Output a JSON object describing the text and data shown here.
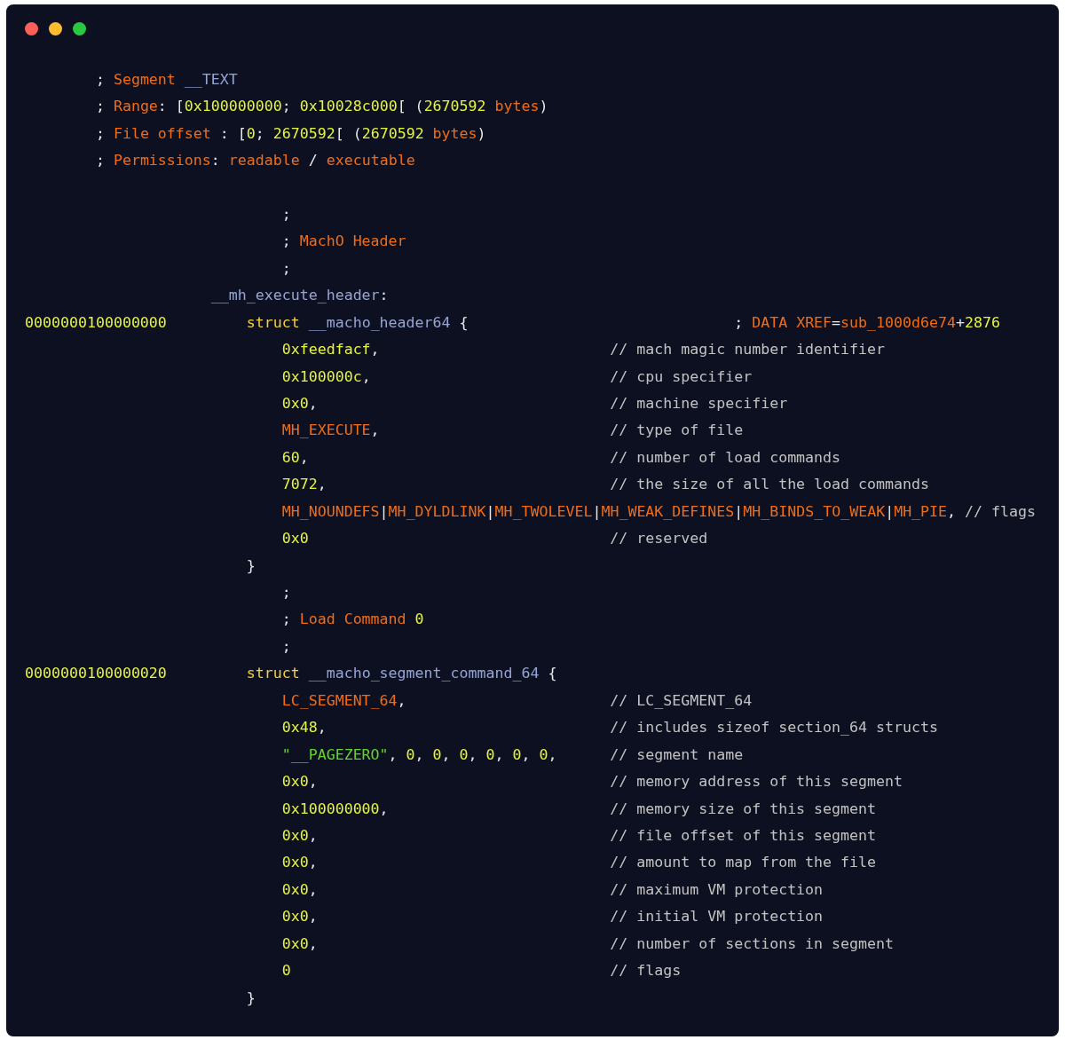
{
  "window": {
    "controls": [
      {
        "kind": "close"
      },
      {
        "kind": "minimize"
      },
      {
        "kind": "zoom"
      }
    ]
  },
  "lines": [
    {
      "kind": "segment",
      "tokens": [
        {
          "text": "; ",
          "kind": "punct"
        },
        {
          "text": "Segment",
          "kind": "keyword"
        },
        {
          "text": " __TEXT",
          "kind": "ident"
        }
      ]
    },
    {
      "kind": "segment",
      "tokens": [
        {
          "text": "; ",
          "kind": "punct"
        },
        {
          "text": "Range",
          "kind": "keyword"
        },
        {
          "text": ": [",
          "kind": "punct"
        },
        {
          "text": "0x100000000",
          "kind": "number"
        },
        {
          "text": "; ",
          "kind": "punct"
        },
        {
          "text": "0x10028c000",
          "kind": "number"
        },
        {
          "text": "[ (",
          "kind": "punct"
        },
        {
          "text": "2670592",
          "kind": "number"
        },
        {
          "text": " bytes",
          "kind": "keyword"
        },
        {
          "text": ")",
          "kind": "punct"
        }
      ]
    },
    {
      "kind": "segment",
      "tokens": [
        {
          "text": "; ",
          "kind": "punct"
        },
        {
          "text": "File offset",
          "kind": "keyword"
        },
        {
          "text": " : [",
          "kind": "punct"
        },
        {
          "text": "0",
          "kind": "number"
        },
        {
          "text": "; ",
          "kind": "punct"
        },
        {
          "text": "2670592",
          "kind": "number"
        },
        {
          "text": "[ (",
          "kind": "punct"
        },
        {
          "text": "2670592",
          "kind": "number"
        },
        {
          "text": " bytes",
          "kind": "keyword"
        },
        {
          "text": ")",
          "kind": "punct"
        }
      ]
    },
    {
      "kind": "segment",
      "tokens": [
        {
          "text": "; ",
          "kind": "punct"
        },
        {
          "text": "Permissions",
          "kind": "keyword"
        },
        {
          "text": ": ",
          "kind": "punct"
        },
        {
          "text": "readable",
          "kind": "keyword"
        },
        {
          "text": " / ",
          "kind": "punct"
        },
        {
          "text": "executable",
          "kind": "keyword"
        }
      ]
    },
    {
      "kind": "blank"
    },
    {
      "kind": "marker",
      "tokens": [
        {
          "text": ";",
          "kind": "punct"
        }
      ]
    },
    {
      "kind": "marker",
      "tokens": [
        {
          "text": "; ",
          "kind": "punct"
        },
        {
          "text": "MachO Header",
          "kind": "keyword"
        }
      ]
    },
    {
      "kind": "marker",
      "tokens": [
        {
          "text": ";",
          "kind": "punct"
        }
      ]
    },
    {
      "kind": "label",
      "tokens": [
        {
          "text": "__mh_execute_header",
          "kind": "ident"
        },
        {
          "text": ":",
          "kind": "punct"
        }
      ]
    },
    {
      "kind": "struct",
      "address": "0000000100000000",
      "tokens": [
        {
          "text": "struct",
          "kind": "type"
        },
        {
          "text": " __macho_header64",
          "kind": "ident"
        },
        {
          "text": " {",
          "kind": "punct"
        }
      ],
      "xref": [
        {
          "text": "; ",
          "kind": "punct"
        },
        {
          "text": "DATA XREF",
          "kind": "keyword"
        },
        {
          "text": "=",
          "kind": "punct"
        },
        {
          "text": "sub_1000d6e74",
          "kind": "keyword"
        },
        {
          "text": "+",
          "kind": "punct"
        },
        {
          "text": "2876",
          "kind": "number"
        }
      ]
    },
    {
      "kind": "field",
      "tokens": [
        {
          "text": "0xfeedfacf",
          "kind": "number"
        },
        {
          "text": ",",
          "kind": "punct"
        }
      ],
      "comment": "// mach magic number identifier"
    },
    {
      "kind": "field",
      "tokens": [
        {
          "text": "0x100000c",
          "kind": "number"
        },
        {
          "text": ",",
          "kind": "punct"
        }
      ],
      "comment": "// cpu specifier"
    },
    {
      "kind": "field",
      "tokens": [
        {
          "text": "0x0",
          "kind": "number"
        },
        {
          "text": ",",
          "kind": "punct"
        }
      ],
      "comment": "// machine specifier"
    },
    {
      "kind": "field",
      "tokens": [
        {
          "text": "MH_EXECUTE",
          "kind": "keyword"
        },
        {
          "text": ",",
          "kind": "punct"
        }
      ],
      "comment": "// type of file"
    },
    {
      "kind": "field",
      "tokens": [
        {
          "text": "60",
          "kind": "number"
        },
        {
          "text": ",",
          "kind": "punct"
        }
      ],
      "comment": "// number of load commands"
    },
    {
      "kind": "field",
      "tokens": [
        {
          "text": "7072",
          "kind": "number"
        },
        {
          "text": ",",
          "kind": "punct"
        }
      ],
      "comment": "// the size of all the load commands"
    },
    {
      "kind": "field",
      "tokens": [
        {
          "text": "MH_NOUNDEFS",
          "kind": "keyword"
        },
        {
          "text": "|",
          "kind": "punct"
        },
        {
          "text": "MH_DYLDLINK",
          "kind": "keyword"
        },
        {
          "text": "|",
          "kind": "punct"
        },
        {
          "text": "MH_TWOLEVEL",
          "kind": "keyword"
        },
        {
          "text": "|",
          "kind": "punct"
        },
        {
          "text": "MH_WEAK_DEFINES",
          "kind": "keyword"
        },
        {
          "text": "|",
          "kind": "punct"
        },
        {
          "text": "MH_BINDS_TO_WEAK",
          "kind": "keyword"
        },
        {
          "text": "|",
          "kind": "punct"
        },
        {
          "text": "MH_PIE",
          "kind": "keyword"
        },
        {
          "text": ",",
          "kind": "punct"
        },
        {
          "text": " // flags",
          "kind": "comment"
        }
      ]
    },
    {
      "kind": "field",
      "tokens": [
        {
          "text": "0x0",
          "kind": "number"
        }
      ],
      "comment": "// reserved"
    },
    {
      "kind": "close",
      "tokens": [
        {
          "text": "}",
          "kind": "punct"
        }
      ]
    },
    {
      "kind": "marker",
      "tokens": [
        {
          "text": ";",
          "kind": "punct"
        }
      ]
    },
    {
      "kind": "marker",
      "tokens": [
        {
          "text": "; ",
          "kind": "punct"
        },
        {
          "text": "Load Command",
          "kind": "keyword"
        },
        {
          "text": " 0",
          "kind": "number"
        }
      ]
    },
    {
      "kind": "marker",
      "tokens": [
        {
          "text": ";",
          "kind": "punct"
        }
      ]
    },
    {
      "kind": "struct",
      "address": "0000000100000020",
      "tokens": [
        {
          "text": "struct",
          "kind": "type"
        },
        {
          "text": " __macho_segment_command_64",
          "kind": "ident"
        },
        {
          "text": " {",
          "kind": "punct"
        }
      ]
    },
    {
      "kind": "field",
      "tokens": [
        {
          "text": "LC_SEGMENT_64",
          "kind": "keyword"
        },
        {
          "text": ",",
          "kind": "punct"
        }
      ],
      "comment": "// LC_SEGMENT_64"
    },
    {
      "kind": "field",
      "tokens": [
        {
          "text": "0x48",
          "kind": "number"
        },
        {
          "text": ",",
          "kind": "punct"
        }
      ],
      "comment": "// includes sizeof section_64 structs"
    },
    {
      "kind": "field",
      "tokens": [
        {
          "text": "\"__PAGEZERO\"",
          "kind": "string"
        },
        {
          "text": ",",
          "kind": "punct"
        },
        {
          "text": " 0",
          "kind": "number"
        },
        {
          "text": ",",
          "kind": "punct"
        },
        {
          "text": " 0",
          "kind": "number"
        },
        {
          "text": ",",
          "kind": "punct"
        },
        {
          "text": " 0",
          "kind": "number"
        },
        {
          "text": ",",
          "kind": "punct"
        },
        {
          "text": " 0",
          "kind": "number"
        },
        {
          "text": ",",
          "kind": "punct"
        },
        {
          "text": " 0",
          "kind": "number"
        },
        {
          "text": ",",
          "kind": "punct"
        },
        {
          "text": " 0",
          "kind": "number"
        },
        {
          "text": ",",
          "kind": "punct"
        }
      ],
      "comment": "// segment name"
    },
    {
      "kind": "field",
      "tokens": [
        {
          "text": "0x0",
          "kind": "number"
        },
        {
          "text": ",",
          "kind": "punct"
        }
      ],
      "comment": "// memory address of this segment"
    },
    {
      "kind": "field",
      "tokens": [
        {
          "text": "0x100000000",
          "kind": "number"
        },
        {
          "text": ",",
          "kind": "punct"
        }
      ],
      "comment": "// memory size of this segment"
    },
    {
      "kind": "field",
      "tokens": [
        {
          "text": "0x0",
          "kind": "number"
        },
        {
          "text": ",",
          "kind": "punct"
        }
      ],
      "comment": "// file offset of this segment"
    },
    {
      "kind": "field",
      "tokens": [
        {
          "text": "0x0",
          "kind": "number"
        },
        {
          "text": ",",
          "kind": "punct"
        }
      ],
      "comment": "// amount to map from the file"
    },
    {
      "kind": "field",
      "tokens": [
        {
          "text": "0x0",
          "kind": "number"
        },
        {
          "text": ",",
          "kind": "punct"
        }
      ],
      "comment": "// maximum VM protection"
    },
    {
      "kind": "field",
      "tokens": [
        {
          "text": "0x0",
          "kind": "number"
        },
        {
          "text": ",",
          "kind": "punct"
        }
      ],
      "comment": "// initial VM protection"
    },
    {
      "kind": "field",
      "tokens": [
        {
          "text": "0x0",
          "kind": "number"
        },
        {
          "text": ",",
          "kind": "punct"
        }
      ],
      "comment": "// number of sections in segment"
    },
    {
      "kind": "field",
      "tokens": [
        {
          "text": "0",
          "kind": "number"
        }
      ],
      "comment": "// flags"
    },
    {
      "kind": "close",
      "tokens": [
        {
          "text": "}",
          "kind": "punct"
        }
      ]
    }
  ]
}
